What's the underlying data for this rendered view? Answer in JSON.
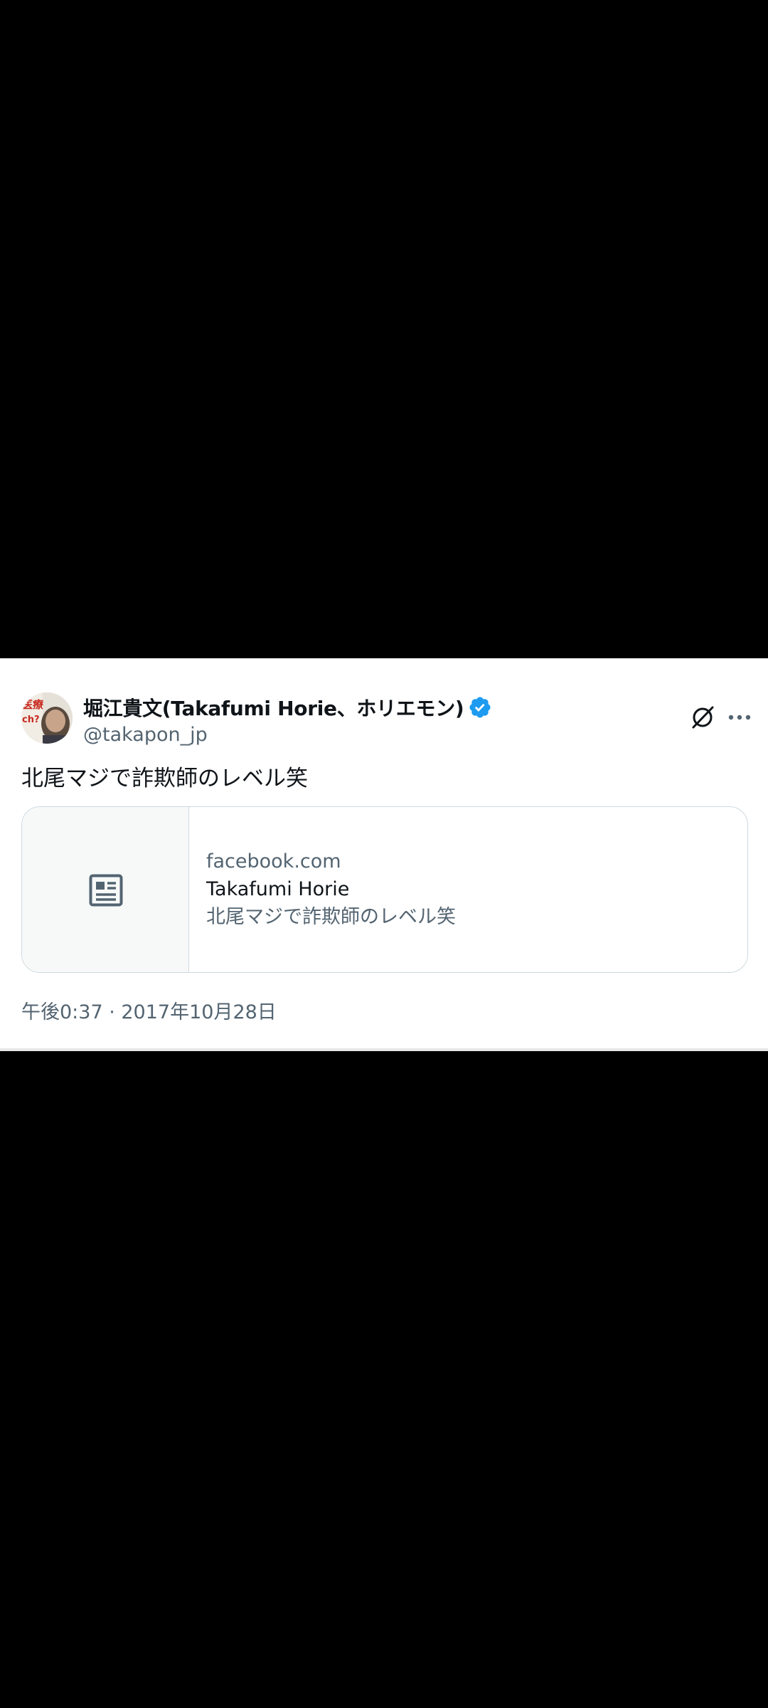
{
  "tweet": {
    "author": {
      "display_name": "堀江貴文(Takafumi Horie、ホリエモン)",
      "handle": "@takapon_jp",
      "verified": true,
      "avatar_icon": "avatar-photo"
    },
    "text": "北尾マジで詐欺師のレベル笑",
    "link_card": {
      "thumbnail_icon": "news-article-icon",
      "domain": "facebook.com",
      "title": "Takafumi Horie",
      "description": "北尾マジで詐欺師のレベル笑"
    },
    "timestamp": "午後0:37 · 2017年10月28日",
    "actions": {
      "grok_icon": "grok-icon",
      "more_icon": "more-options-icon"
    }
  },
  "colors": {
    "background": "#000000",
    "card_background": "#ffffff",
    "primary_text": "#0f1419",
    "secondary_text": "#536471",
    "border": "#cfd9de",
    "verified_blue": "#1d9bf0",
    "thumb_background": "#f7f9f9"
  }
}
